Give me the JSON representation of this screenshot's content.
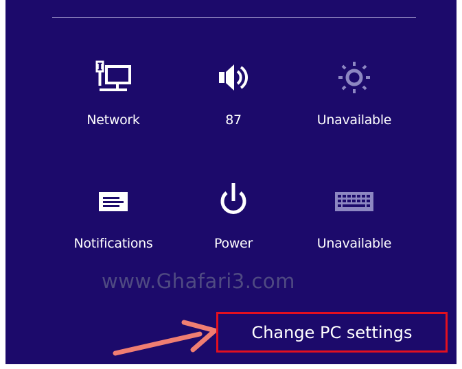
{
  "quick_settings": [
    {
      "id": "network",
      "label": "Network",
      "icon": "network-icon"
    },
    {
      "id": "volume",
      "label": "87",
      "icon": "speaker-icon"
    },
    {
      "id": "brightness",
      "label": "Unavailable",
      "icon": "brightness-icon"
    },
    {
      "id": "notifications",
      "label": "Notifications",
      "icon": "notifications-icon"
    },
    {
      "id": "power",
      "label": "Power",
      "icon": "power-icon"
    },
    {
      "id": "keyboard",
      "label": "Unavailable",
      "icon": "keyboard-icon"
    }
  ],
  "watermark": "www.Ghafari3.com",
  "change_pc_settings": "Change PC settings",
  "colors": {
    "panel_background": "#1c0a6b",
    "highlight_box": "#e3101f",
    "arrow": "#f07e72"
  }
}
